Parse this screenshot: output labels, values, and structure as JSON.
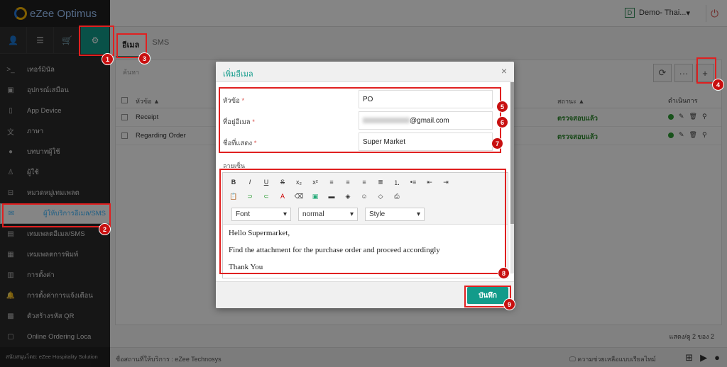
{
  "app": {
    "brand": "eZee Optimus",
    "property": "Demo- Thai...",
    "property_initial": "D"
  },
  "sidebar": {
    "items": [
      {
        "icon": "terminal-icon",
        "label": "เทอร์มินัล"
      },
      {
        "icon": "device-icon",
        "label": "อุปกรณ์เสมือน"
      },
      {
        "icon": "mobile-icon",
        "label": "App Device"
      },
      {
        "icon": "language-icon",
        "label": "ภาษา"
      },
      {
        "icon": "user-role-icon",
        "label": "บทบาทผู้ใช้"
      },
      {
        "icon": "user-icon",
        "label": "ผู้ใช้"
      },
      {
        "icon": "inbox-icon",
        "label": "หมวดหมู่เทมเพลต"
      },
      {
        "icon": "mail-icon",
        "label": "ผู้ให้บริการอีเมล/SMS"
      },
      {
        "icon": "template-icon",
        "label": "เทมเพลตอีเมล/SMS"
      },
      {
        "icon": "print-template-icon",
        "label": "เทมเพลตการพิมพ์"
      },
      {
        "icon": "settings-icon",
        "label": "การตั้งค่า"
      },
      {
        "icon": "bell-icon",
        "label": "การตั้งค่าการแจ้งเตือน"
      },
      {
        "icon": "qr-icon",
        "label": "ตัวสร้างรหัส QR"
      },
      {
        "icon": "online-order-icon",
        "label": "Online Ordering Loca"
      }
    ],
    "powered_by": "สนับสนุนโดย: eZee Hospitality Solution"
  },
  "tabs": [
    {
      "label": "อีเมล"
    },
    {
      "label": "SMS"
    }
  ],
  "list": {
    "search_placeholder": "ค้นหา",
    "columns": {
      "subject": "หัวข้อ",
      "status": "สถานะ",
      "action": "ดำเนินการ"
    },
    "rows": [
      {
        "subject": "Receipt",
        "status": "ตรวจสอบแล้ว"
      },
      {
        "subject": "Regarding Order",
        "status": "ตรวจสอบแล้ว"
      }
    ],
    "pager": "แสดง/ดู 2 ของ 2"
  },
  "footer": {
    "hotel": "ชื่อสถานที่ให้บริการ : eZee Technosys",
    "help": "ความช่วยเหลือแบบเรียลไทม์"
  },
  "modal": {
    "title": "เพิ่มอีเมล",
    "close": "×",
    "fields": {
      "subject_label": "หัวข้อ",
      "subject_value": "PO",
      "email_label": "ที่อยู่อีเมล",
      "email_domain": "@gmail.com",
      "display_label": "ชื่อที่แสดง",
      "display_value": "Super Market"
    },
    "signature_label": "ลายเซ็น",
    "editor": {
      "font": "Font",
      "size": "normal",
      "style": "Style",
      "line1": "Hello Supermarket,",
      "line2": "Find the attachment for the purchase order and proceed accordingly",
      "line3": "Thank You"
    },
    "save": "บันทึก"
  },
  "annotations": [
    "1",
    "2",
    "3",
    "4",
    "5",
    "6",
    "7",
    "8",
    "9"
  ],
  "colors": {
    "accent": "#129b8a",
    "highlight": "#e02020",
    "badge": "#c81010"
  }
}
